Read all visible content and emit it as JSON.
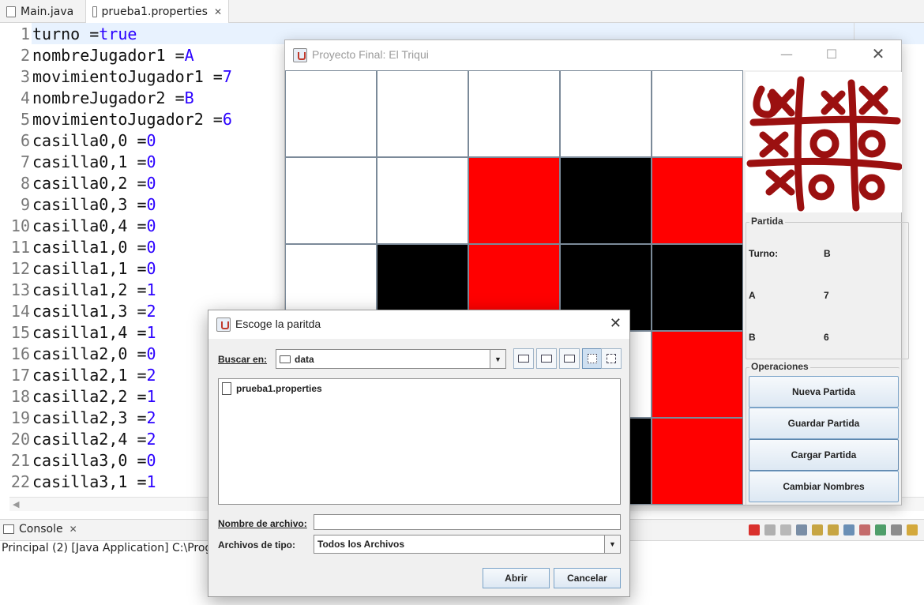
{
  "editor": {
    "tabs": [
      {
        "label": "Main.java"
      },
      {
        "label": "prueba1.properties"
      }
    ],
    "lines": [
      {
        "n": "1",
        "key": "turno =",
        "val": "true"
      },
      {
        "n": "2",
        "key": "nombreJugador1 =",
        "val": "A"
      },
      {
        "n": "3",
        "key": "movimientoJugador1 =",
        "val": "7"
      },
      {
        "n": "4",
        "key": "nombreJugador2 =",
        "val": "B"
      },
      {
        "n": "5",
        "key": "movimientoJugador2 =",
        "val": "6"
      },
      {
        "n": "6",
        "key": "casilla0,0 =",
        "val": "0"
      },
      {
        "n": "7",
        "key": "casilla0,1 =",
        "val": "0"
      },
      {
        "n": "8",
        "key": "casilla0,2 =",
        "val": "0"
      },
      {
        "n": "9",
        "key": "casilla0,3 =",
        "val": "0"
      },
      {
        "n": "10",
        "key": "casilla0,4 =",
        "val": "0"
      },
      {
        "n": "11",
        "key": "casilla1,0 =",
        "val": "0"
      },
      {
        "n": "12",
        "key": "casilla1,1 =",
        "val": "0"
      },
      {
        "n": "13",
        "key": "casilla1,2 =",
        "val": "1"
      },
      {
        "n": "14",
        "key": "casilla1,3 =",
        "val": "2"
      },
      {
        "n": "15",
        "key": "casilla1,4 =",
        "val": "1"
      },
      {
        "n": "16",
        "key": "casilla2,0 =",
        "val": "0"
      },
      {
        "n": "17",
        "key": "casilla2,1 =",
        "val": "2"
      },
      {
        "n": "18",
        "key": "casilla2,2 =",
        "val": "1"
      },
      {
        "n": "19",
        "key": "casilla2,3 =",
        "val": "2"
      },
      {
        "n": "20",
        "key": "casilla2,4 =",
        "val": "2"
      },
      {
        "n": "21",
        "key": "casilla3,0 =",
        "val": "0"
      },
      {
        "n": "22",
        "key": "casilla3,1 =",
        "val": "1"
      }
    ]
  },
  "console": {
    "tab_label": "Console",
    "status": "Principal (2) [Java Application] C:\\Progra"
  },
  "game_window": {
    "title": "Proyecto Final: El Triqui",
    "board": [
      [
        0,
        0,
        0,
        0,
        0
      ],
      [
        0,
        0,
        1,
        2,
        1
      ],
      [
        0,
        2,
        1,
        2,
        2
      ],
      [
        0,
        0,
        0,
        0,
        1
      ],
      [
        0,
        0,
        0,
        2,
        1
      ]
    ],
    "board_colors": {
      "0": "#ffffff",
      "1": "#ff0000",
      "2": "#000000"
    },
    "partida": {
      "label": "Partida",
      "turno_label": "Turno:",
      "turno_value": "B",
      "player1_name": "A",
      "player1_moves": "7",
      "player2_name": "B",
      "player2_moves": "6"
    },
    "operaciones": {
      "label": "Operaciones",
      "buttons": [
        "Nueva Partida",
        "Guardar Partida",
        "Cargar Partida",
        "Cambiar Nombres"
      ]
    }
  },
  "file_dialog": {
    "title": "Escoge la paritda",
    "look_in_label": "Buscar en:",
    "look_in_value": "data",
    "files": [
      "prueba1.properties"
    ],
    "filename_label": "Nombre de archivo:",
    "filename_value": "",
    "filetype_label": "Archivos de tipo:",
    "filetype_value": "Todos los Archivos",
    "open_button": "Abrir",
    "cancel_button": "Cancelar"
  }
}
